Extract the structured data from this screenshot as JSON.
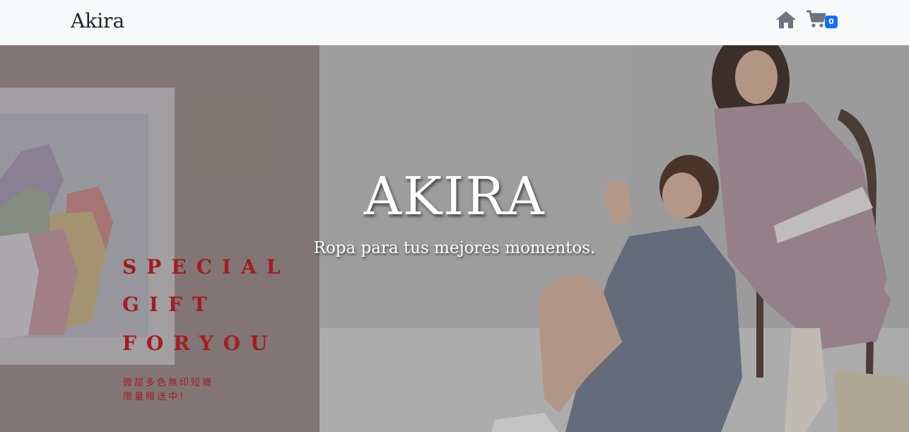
{
  "navbar": {
    "brand": "Akira",
    "home_icon": "home-icon",
    "cart_icon": "shopping-cart-icon",
    "cart_count": "0"
  },
  "hero": {
    "title": "AKIRA",
    "subtitle": "Ropa para tus mejores momentos.",
    "promo": {
      "line1": "SPECIAL",
      "line2": "GIFT",
      "line3": "FORYOU",
      "cjk_line1": "微甜多色無印短襪",
      "cjk_line2": "限量贈送中!"
    }
  },
  "colors": {
    "navbar_bg": "#f8f9fa",
    "badge": "#0d6efd",
    "promo_text": "#a41d1d",
    "icon": "#6c757d"
  }
}
